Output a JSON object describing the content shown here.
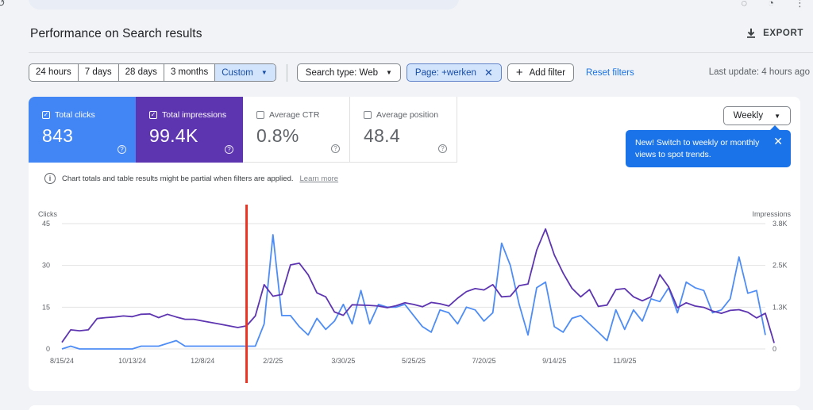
{
  "page": {
    "title": "Performance on Search results",
    "export_label": "EXPORT",
    "last_update": "Last update: 4 hours ago"
  },
  "filters": {
    "date_ranges": [
      "24 hours",
      "7 days",
      "28 days",
      "3 months",
      "Custom"
    ],
    "active_range": "Custom",
    "search_type": "Search type: Web",
    "page_filter": "Page: +werken",
    "add_filter": "Add filter",
    "reset": "Reset filters"
  },
  "metrics": [
    {
      "label": "Total clicks",
      "value": "843",
      "checked": true,
      "color": "#4285f4"
    },
    {
      "label": "Total impressions",
      "value": "99.4K",
      "checked": true,
      "color": "#5e35b1"
    },
    {
      "label": "Average CTR",
      "value": "0.8%",
      "checked": false
    },
    {
      "label": "Average position",
      "value": "48.4",
      "checked": false
    }
  ],
  "granularity": {
    "selected": "Weekly",
    "tooltip": "New! Switch to weekly or monthly views to spot trends."
  },
  "notice": {
    "text": "Chart totals and table results might be partial when filters are applied.",
    "link": "Learn more"
  },
  "chart_data": {
    "type": "line",
    "left_axis_label": "Clicks",
    "right_axis_label": "Impressions",
    "left_ticks": [
      "45",
      "30",
      "15",
      "0"
    ],
    "left_tick_values": [
      45,
      30,
      15,
      0
    ],
    "right_ticks": [
      "3.8K",
      "2.5K",
      "1.3K",
      "0"
    ],
    "x_ticks": [
      "8/15/24",
      "10/13/24",
      "12/8/24",
      "2/2/25",
      "3/30/25",
      "5/25/25",
      "7/20/25",
      "9/14/25",
      "11/9/25"
    ],
    "ylim_left": [
      0,
      45
    ],
    "ylim_right": [
      0,
      3800
    ],
    "marker_color": "#ea3323",
    "marker_week_index": 21,
    "series": [
      {
        "name": "Clicks",
        "axis": "left",
        "color": "#4e8df5",
        "values": [
          0,
          1,
          0,
          0,
          0,
          0,
          0,
          0,
          0,
          1,
          1,
          1,
          2,
          3,
          1,
          1,
          1,
          1,
          1,
          1,
          1,
          1,
          1,
          9,
          41,
          12,
          12,
          8,
          5,
          11,
          7,
          10,
          16,
          9,
          21,
          9,
          16,
          15,
          15,
          16,
          12,
          8,
          6,
          14,
          13,
          9,
          15,
          14,
          10,
          13,
          38,
          30,
          16,
          5,
          22,
          24,
          8,
          6,
          11,
          12,
          9,
          6,
          3,
          14,
          7,
          14,
          10,
          18,
          17,
          22,
          13,
          24,
          22,
          21,
          13,
          14,
          18,
          33,
          20,
          21,
          5
        ]
      },
      {
        "name": "Impressions",
        "axis": "right",
        "color": "#5e35b1",
        "values": [
          200,
          580,
          550,
          580,
          920,
          950,
          970,
          1000,
          980,
          1050,
          1060,
          950,
          1050,
          970,
          900,
          900,
          850,
          800,
          750,
          700,
          650,
          700,
          1000,
          1950,
          1600,
          1650,
          2550,
          2600,
          2250,
          1700,
          1580,
          1120,
          1020,
          1340,
          1330,
          1320,
          1300,
          1250,
          1310,
          1400,
          1350,
          1280,
          1410,
          1370,
          1300,
          1540,
          1740,
          1830,
          1790,
          1950,
          1580,
          1600,
          1920,
          1970,
          3000,
          3640,
          2850,
          2300,
          1840,
          1580,
          1800,
          1290,
          1330,
          1800,
          1830,
          1580,
          1460,
          1580,
          2250,
          1880,
          1250,
          1400,
          1300,
          1260,
          1150,
          1080,
          1170,
          1190,
          1110,
          940,
          1080,
          180
        ]
      }
    ]
  }
}
